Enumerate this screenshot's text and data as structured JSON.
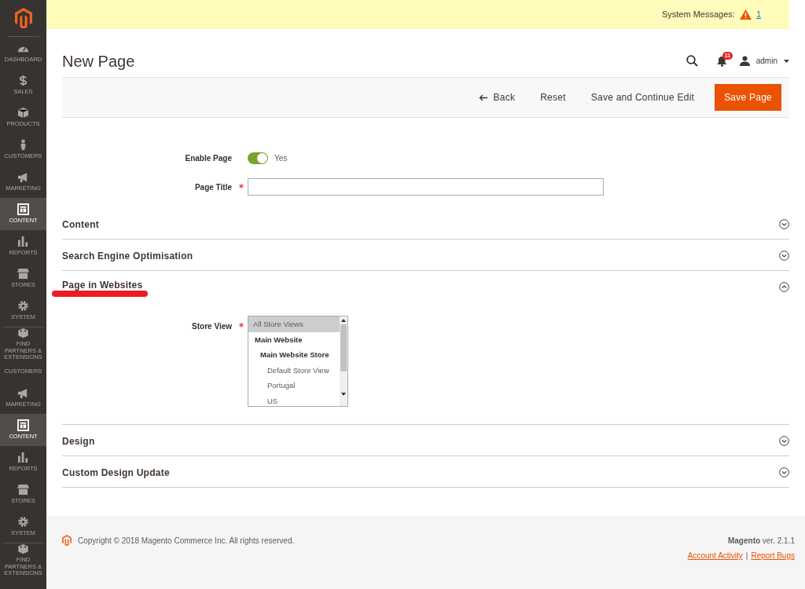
{
  "sidebar": {
    "items": [
      {
        "kind": "dashboard",
        "label": "DASHBOARD",
        "selected": false
      },
      {
        "kind": "sales",
        "label": "SALES",
        "selected": false
      },
      {
        "kind": "products",
        "label": "PRODUCTS",
        "selected": false
      },
      {
        "kind": "customers",
        "label": "CUSTOMERS",
        "selected": false
      },
      {
        "kind": "marketing",
        "label": "MARKETING",
        "selected": false
      },
      {
        "kind": "content",
        "label": "CONTENT",
        "selected": true
      },
      {
        "kind": "reports",
        "label": "REPORTS",
        "selected": false
      },
      {
        "kind": "stores",
        "label": "STORES",
        "selected": false
      },
      {
        "kind": "system",
        "label": "SYSTEM",
        "selected": false
      },
      {
        "kind": "partners",
        "label": "FIND PARTNERS & EXTENSIONS",
        "selected": false
      },
      {
        "kind": "plain",
        "label": "CUSTOMERS",
        "selected": false
      },
      {
        "kind": "marketing",
        "label": "MARKETING",
        "selected": false
      },
      {
        "kind": "content",
        "label": "CONTENT",
        "selected": true
      },
      {
        "kind": "reports",
        "label": "REPORTS",
        "selected": false
      },
      {
        "kind": "stores",
        "label": "STORES",
        "selected": false
      },
      {
        "kind": "system",
        "label": "SYSTEM",
        "selected": false
      },
      {
        "kind": "partners",
        "label": "FIND PARTNERS & EXTENSIONS",
        "selected": false
      }
    ]
  },
  "system_messages": {
    "label": "System Messages:",
    "count": "1"
  },
  "header": {
    "title": "New Page",
    "notifications": "11",
    "user": "admin"
  },
  "actions": {
    "back": "Back",
    "reset": "Reset",
    "save_continue": "Save and Continue Edit",
    "save": "Save Page"
  },
  "form": {
    "enable_page": {
      "label": "Enable Page",
      "on": true,
      "value": "Yes"
    },
    "page_title": {
      "label": "Page Title",
      "required": true
    }
  },
  "sections": [
    {
      "title": "Content",
      "expanded": false,
      "annotated": false
    },
    {
      "title": "Search Engine Optimisation",
      "expanded": false,
      "annotated": false
    },
    {
      "title": "Page in Websites",
      "expanded": true,
      "annotated": true,
      "store_view": {
        "label": "Store View",
        "required": true,
        "options": [
          {
            "label": "All Store Views",
            "selected": true
          },
          {
            "label": "Main Website",
            "selected": false,
            "children": [
              {
                "label": "Main Website Store",
                "selected": false,
                "children": [
                  {
                    "label": "Default Store View",
                    "selected": false
                  },
                  {
                    "label": "Portugal",
                    "selected": false
                  },
                  {
                    "label": "US",
                    "selected": false
                  }
                ]
              }
            ]
          }
        ]
      }
    },
    {
      "title": "Design",
      "expanded": false,
      "annotated": false
    },
    {
      "title": "Custom Design Update",
      "expanded": false,
      "annotated": false
    }
  ],
  "footer": {
    "copyright": "Copyright © 2018 Magento Commerce Inc. All rights reserved.",
    "brand": "Magento",
    "version": "ver. 2.1.1",
    "links": [
      "Account Activity",
      "Report Bugs"
    ],
    "separator": "|"
  }
}
